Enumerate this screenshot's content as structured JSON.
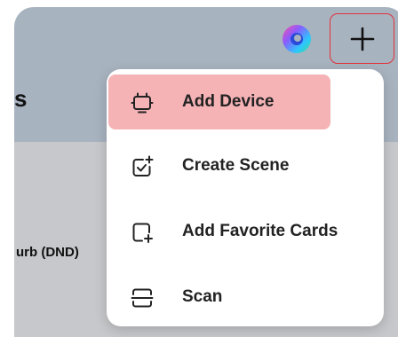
{
  "page": {
    "title_fragment": "s",
    "dnd_label": "urb (DND)"
  },
  "header": {
    "avatar_icon": "colorful-ring-logo",
    "add_button_icon": "plus-icon"
  },
  "menu": {
    "items": [
      {
        "label": "Add Device",
        "icon": "device-icon",
        "highlighted": true
      },
      {
        "label": "Create Scene",
        "icon": "scene-icon"
      },
      {
        "label": "Add Favorite Cards",
        "icon": "favorite-card-icon"
      },
      {
        "label": "Scan",
        "icon": "scan-icon"
      }
    ]
  },
  "colors": {
    "header_bg": "#a8b3c0",
    "card_bg": "#c7c8cb",
    "highlight": "#f5b3b6",
    "accent_red": "#e2323a"
  }
}
